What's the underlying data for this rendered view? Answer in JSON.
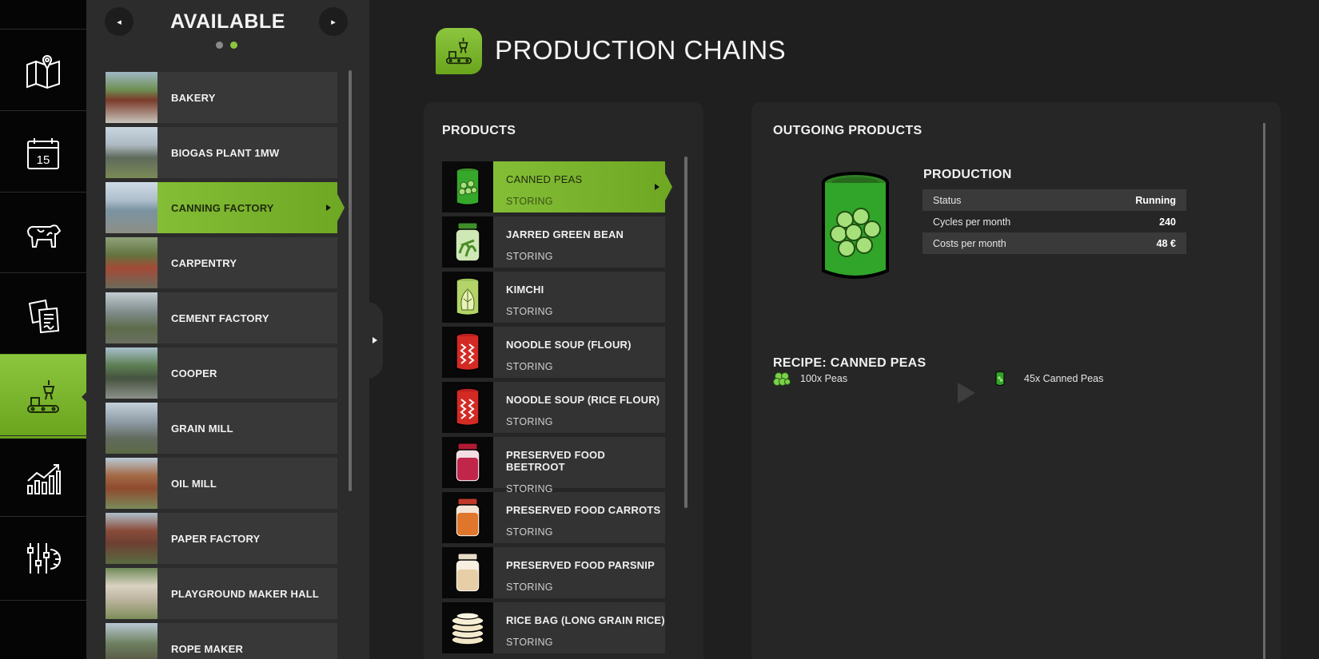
{
  "sidebar": {
    "items": [
      {
        "icon": "map-icon"
      },
      {
        "icon": "calendar-icon",
        "day": "15"
      },
      {
        "icon": "cow-icon"
      },
      {
        "icon": "contracts-icon"
      },
      {
        "icon": "production-icon",
        "active": true
      },
      {
        "icon": "statistics-icon"
      },
      {
        "icon": "settings-icon"
      }
    ]
  },
  "available": {
    "title": "AVAILABLE",
    "page_dots": 2,
    "active_dot": 2,
    "facilities": [
      {
        "name": "BAKERY"
      },
      {
        "name": "BIOGAS PLANT 1MW"
      },
      {
        "name": "CANNING FACTORY",
        "active": true
      },
      {
        "name": "CARPENTRY"
      },
      {
        "name": "CEMENT FACTORY"
      },
      {
        "name": "COOPER"
      },
      {
        "name": "GRAIN MILL"
      },
      {
        "name": "OIL MILL"
      },
      {
        "name": "PAPER FACTORY"
      },
      {
        "name": "PLAYGROUND MAKER HALL"
      },
      {
        "name": "ROPE MAKER"
      }
    ]
  },
  "header": {
    "title": "PRODUCTION CHAINS",
    "icon": "production-icon"
  },
  "products": {
    "title": "PRODUCTS",
    "items": [
      {
        "name": "CANNED PEAS",
        "status": "STORING",
        "icon": "canned-peas-icon",
        "active": true
      },
      {
        "name": "JARRED GREEN BEAN",
        "status": "STORING",
        "icon": "jarred-green-bean-icon"
      },
      {
        "name": "KIMCHI",
        "status": "STORING",
        "icon": "kimchi-icon"
      },
      {
        "name": "NOODLE SOUP (FLOUR)",
        "status": "STORING",
        "icon": "noodle-soup-icon"
      },
      {
        "name": "NOODLE SOUP (RICE FLOUR)",
        "status": "STORING",
        "icon": "noodle-soup-icon"
      },
      {
        "name": "PRESERVED FOOD BEETROOT",
        "status": "STORING",
        "icon": "preserved-beetroot-icon"
      },
      {
        "name": "PRESERVED FOOD CARROTS",
        "status": "STORING",
        "icon": "preserved-carrots-icon"
      },
      {
        "name": "PRESERVED FOOD PARSNIP",
        "status": "STORING",
        "icon": "preserved-parsnip-icon"
      },
      {
        "name": "RICE BAG (LONG GRAIN RICE)",
        "status": "STORING",
        "icon": "rice-bag-icon"
      }
    ]
  },
  "outgoing": {
    "title": "OUTGOING PRODUCTS",
    "product_icon": "canned-peas-icon",
    "production": {
      "title": "PRODUCTION",
      "rows": [
        {
          "label": "Status",
          "value": "Running"
        },
        {
          "label": "Cycles per month",
          "value": "240"
        },
        {
          "label": "Costs per month",
          "value": "48 €"
        }
      ]
    },
    "recipe": {
      "title": "RECIPE: CANNED PEAS",
      "input": {
        "label": "100x Peas",
        "icon": "peas-icon"
      },
      "arrow_icon": "play-arrow-icon",
      "output": {
        "label": "45x Canned Peas",
        "icon": "canned-peas-icon"
      }
    }
  },
  "colors": {
    "accent": "#8cc63f",
    "accent_dark": "#6fa823",
    "panel": "#262626",
    "rail": "#050505"
  }
}
